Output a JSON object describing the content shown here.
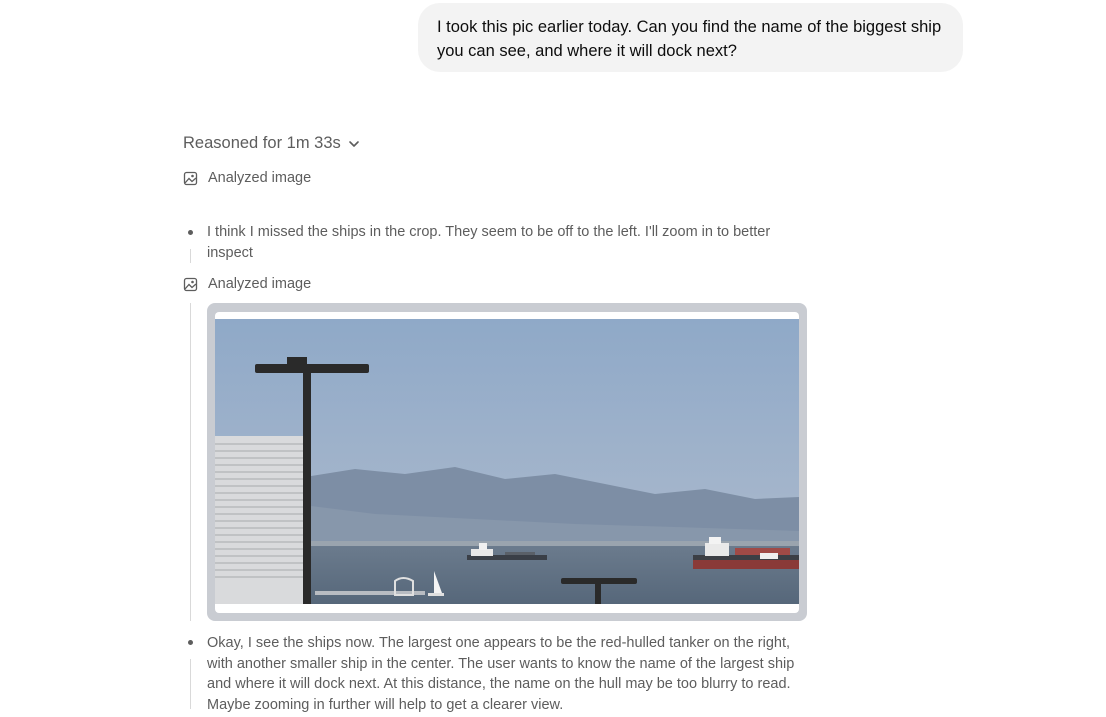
{
  "user_message": {
    "text": "I took this pic earlier today. Can you find the name of the biggest ship you can see, and where it will dock next?"
  },
  "reasoning": {
    "header": "Reasoned for 1m 33s",
    "steps": [
      {
        "type": "action",
        "label": "Analyzed image",
        "icon": "image-icon"
      },
      {
        "type": "thought",
        "text": "I think I missed the ships in the crop. They seem to be off to the left. I'll zoom in to better inspect"
      },
      {
        "type": "action",
        "label": "Analyzed image",
        "icon": "image-icon"
      },
      {
        "type": "image",
        "description_icon": "zoomed-photo"
      },
      {
        "type": "thought",
        "text": "Okay, I see the ships now. The largest one appears to be the red-hulled tanker on the right, with another smaller ship in the center. The user wants to know the name of the largest ship and where it will dock next. At this distance, the name on the hull may be too blurry to read. Maybe zooming in further will help to get a clearer view."
      }
    ]
  },
  "colors": {
    "bubble_bg": "#f3f3f3",
    "muted_text": "#5d5d5d",
    "tanker_hull": "#8a3a38"
  }
}
